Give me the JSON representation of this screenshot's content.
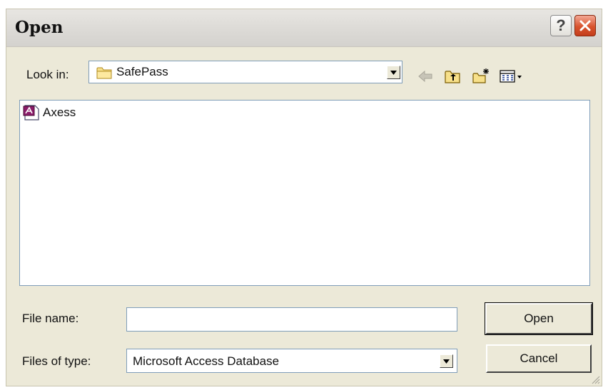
{
  "window": {
    "title": "Open",
    "help_label": "?"
  },
  "look_in": {
    "label": "Look in:",
    "value": "SafePass",
    "folder_icon": "folder-icon"
  },
  "toolbar": {
    "icons": [
      "back-arrow-icon",
      "up-one-level-icon",
      "new-folder-icon",
      "view-menu-icon"
    ]
  },
  "files": [
    {
      "name": "Axess",
      "icon": "access-database-icon"
    }
  ],
  "file_name": {
    "label": "File name:",
    "value": ""
  },
  "file_type": {
    "label": "Files of type:",
    "value": "Microsoft Access Database"
  },
  "buttons": {
    "open_label": "Open",
    "cancel_label": "Cancel"
  },
  "colors": {
    "dialog_bg": "#ece9d8",
    "close_button": "#d8532e",
    "field_border": "#7f9db9"
  }
}
